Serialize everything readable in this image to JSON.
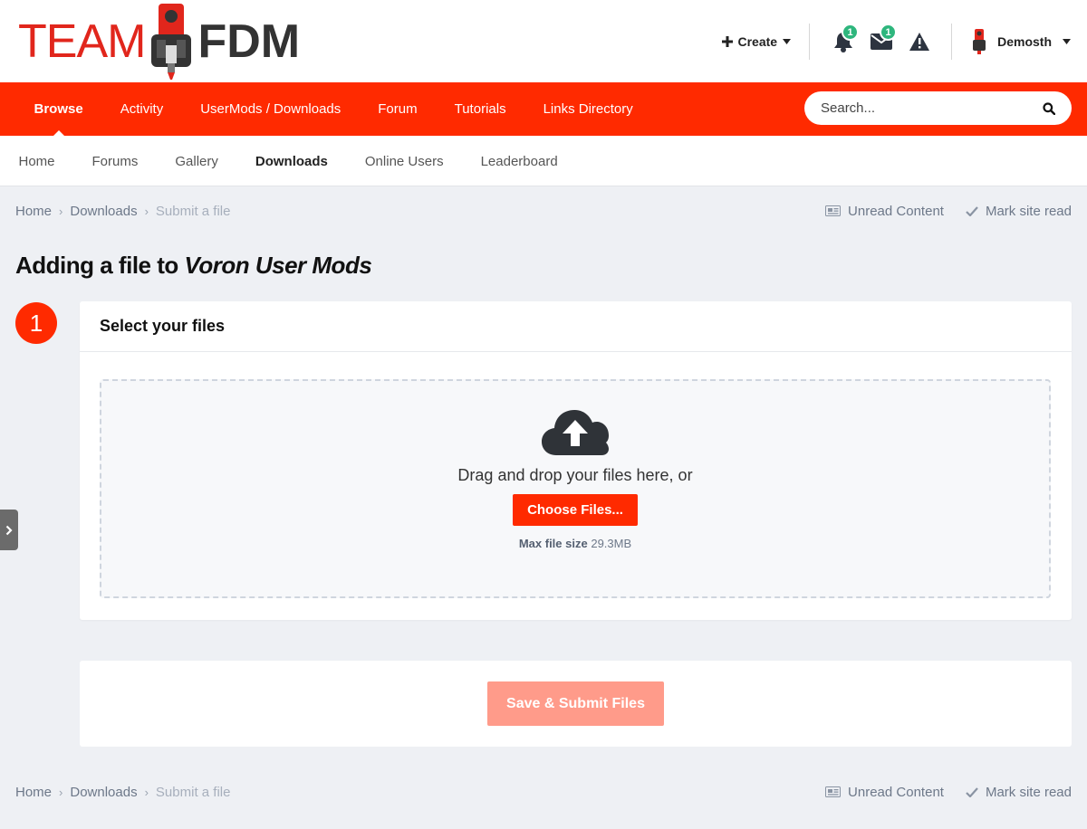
{
  "header": {
    "logo_team": "TEAM",
    "logo_fdm": "FDM",
    "create_label": "Create",
    "notifications_count": "1",
    "messages_count": "1",
    "username": "Demosth",
    "icons": [
      "plus-icon",
      "caret-down-icon",
      "bell-icon",
      "envelope-icon",
      "warning-icon",
      "avatar"
    ]
  },
  "primary_nav": {
    "items": [
      {
        "label": "Browse"
      },
      {
        "label": "Activity"
      },
      {
        "label": "UserMods / Downloads"
      },
      {
        "label": "Forum"
      },
      {
        "label": "Tutorials"
      },
      {
        "label": "Links Directory"
      }
    ],
    "search_placeholder": "Search..."
  },
  "secondary_nav": {
    "items": [
      {
        "label": "Home"
      },
      {
        "label": "Forums"
      },
      {
        "label": "Gallery"
      },
      {
        "label": "Downloads"
      },
      {
        "label": "Online Users"
      },
      {
        "label": "Leaderboard"
      }
    ]
  },
  "breadcrumb": {
    "home": "Home",
    "downloads": "Downloads",
    "current": "Submit a file",
    "unread_content": "Unread Content",
    "mark_read": "Mark site read"
  },
  "page": {
    "title_prefix": "Adding a file to ",
    "title_category": "Voron User Mods"
  },
  "step": {
    "number": "1",
    "title": "Select your files",
    "drop_text": "Drag and drop your files here, or",
    "choose_button": "Choose Files...",
    "max_size_label": "Max file size",
    "max_size_value": "29.3MB"
  },
  "submit": {
    "button_label": "Save & Submit Files"
  },
  "colors": {
    "brand": "#ff2a00",
    "badge": "#2eb67d",
    "submit_disabled": "#ff9b8a"
  }
}
